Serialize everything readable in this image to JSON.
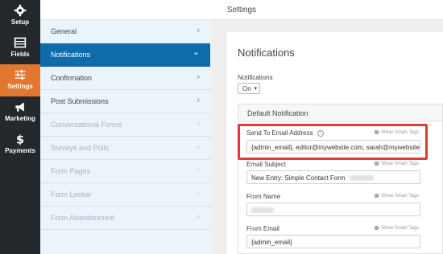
{
  "header": {
    "title": "Settings"
  },
  "leftbar": {
    "items": [
      {
        "label": "Setup",
        "icon": "gear-icon"
      },
      {
        "label": "Fields",
        "icon": "list-icon"
      },
      {
        "label": "Settings",
        "icon": "sliders-icon"
      },
      {
        "label": "Marketing",
        "icon": "megaphone-icon"
      },
      {
        "label": "Payments",
        "icon": "dollar-icon"
      }
    ],
    "active_color": "#e27730",
    "bg_color": "#23282d"
  },
  "nav": {
    "items": [
      {
        "label": "General"
      },
      {
        "label": "Notifications"
      },
      {
        "label": "Confirmation"
      },
      {
        "label": "Post Submissions"
      },
      {
        "label": "Conversational Forms"
      },
      {
        "label": "Surveys and Polls"
      },
      {
        "label": "Form Pages"
      },
      {
        "label": "Form Locker"
      },
      {
        "label": "Form Abandonment"
      }
    ],
    "active_color": "#0e6cad",
    "chevron": "›",
    "chevron_down": "⌄"
  },
  "main": {
    "title": "Notifications",
    "notifications_label": "Notifications",
    "notifications_value": "On",
    "section_title": "Default Notification",
    "smart_tags": "Show Smart Tags",
    "fields": {
      "send_to": {
        "label": "Send To Email Address",
        "value": "{admin_email}, editor@mywebsite.com, sarah@mywebsite.com"
      },
      "subject": {
        "label": "Email Subject",
        "value": "New Entry: Simple Contact Form"
      },
      "from_name": {
        "label": "From Name",
        "value": ""
      },
      "from_email": {
        "label": "From Email",
        "value": "{admin_email}"
      }
    },
    "highlight_color": "#e23a3a"
  }
}
